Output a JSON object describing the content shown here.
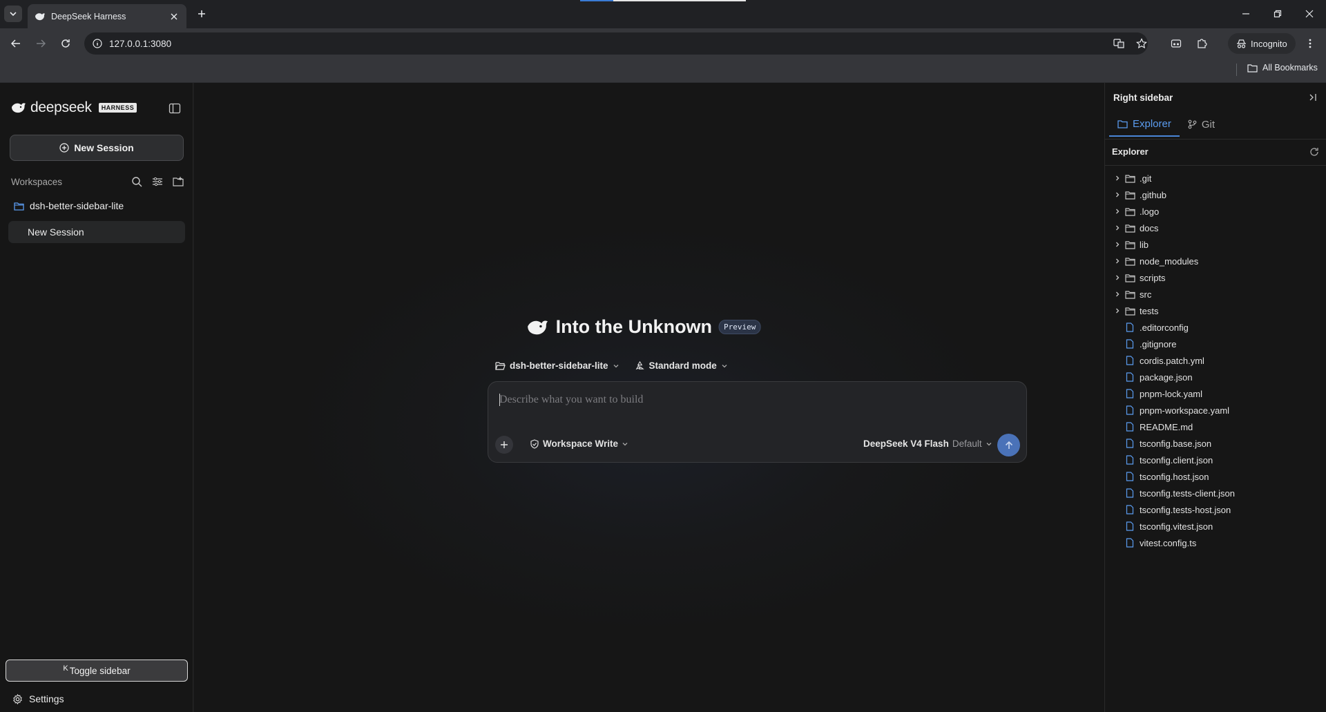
{
  "browser": {
    "tab_title": "DeepSeek Harness",
    "url": "127.0.0.1:3080",
    "incognito_label": "Incognito",
    "bookmarks_label": "All Bookmarks"
  },
  "left_sidebar": {
    "logo_text": "deepseek",
    "logo_badge": "HARNESS",
    "new_session_label": "New Session",
    "workspaces_label": "Workspaces",
    "workspace_name": "dsh-better-sidebar-lite",
    "session_name": "New Session",
    "toggle_key": "K",
    "toggle_label": "Toggle sidebar",
    "settings_label": "Settings"
  },
  "main": {
    "hero_title": "Into the Unknown",
    "preview_badge": "Preview",
    "workspace_selector": "dsh-better-sidebar-lite",
    "mode_selector": "Standard mode",
    "composer_placeholder": "Describe what you want to build",
    "permission_label": "Workspace Write",
    "model_name": "DeepSeek V4 Flash",
    "model_tag": "Default"
  },
  "right_sidebar": {
    "title": "Right sidebar",
    "tabs": [
      {
        "label": "Explorer",
        "active": true
      },
      {
        "label": "Git",
        "active": false
      }
    ],
    "explorer_label": "Explorer",
    "folders": [
      ".git",
      ".github",
      ".logo",
      "docs",
      "lib",
      "node_modules",
      "scripts",
      "src",
      "tests"
    ],
    "files": [
      ".editorconfig",
      ".gitignore",
      "cordis.patch.yml",
      "package.json",
      "pnpm-lock.yaml",
      "pnpm-workspace.yaml",
      "README.md",
      "tsconfig.base.json",
      "tsconfig.client.json",
      "tsconfig.host.json",
      "tsconfig.tests-client.json",
      "tsconfig.tests-host.json",
      "tsconfig.vitest.json",
      "vitest.config.ts"
    ]
  },
  "colors": {
    "accent": "#4a86d8",
    "send_button": "#4a72b8",
    "folder_icon": "#5b9cf0"
  }
}
